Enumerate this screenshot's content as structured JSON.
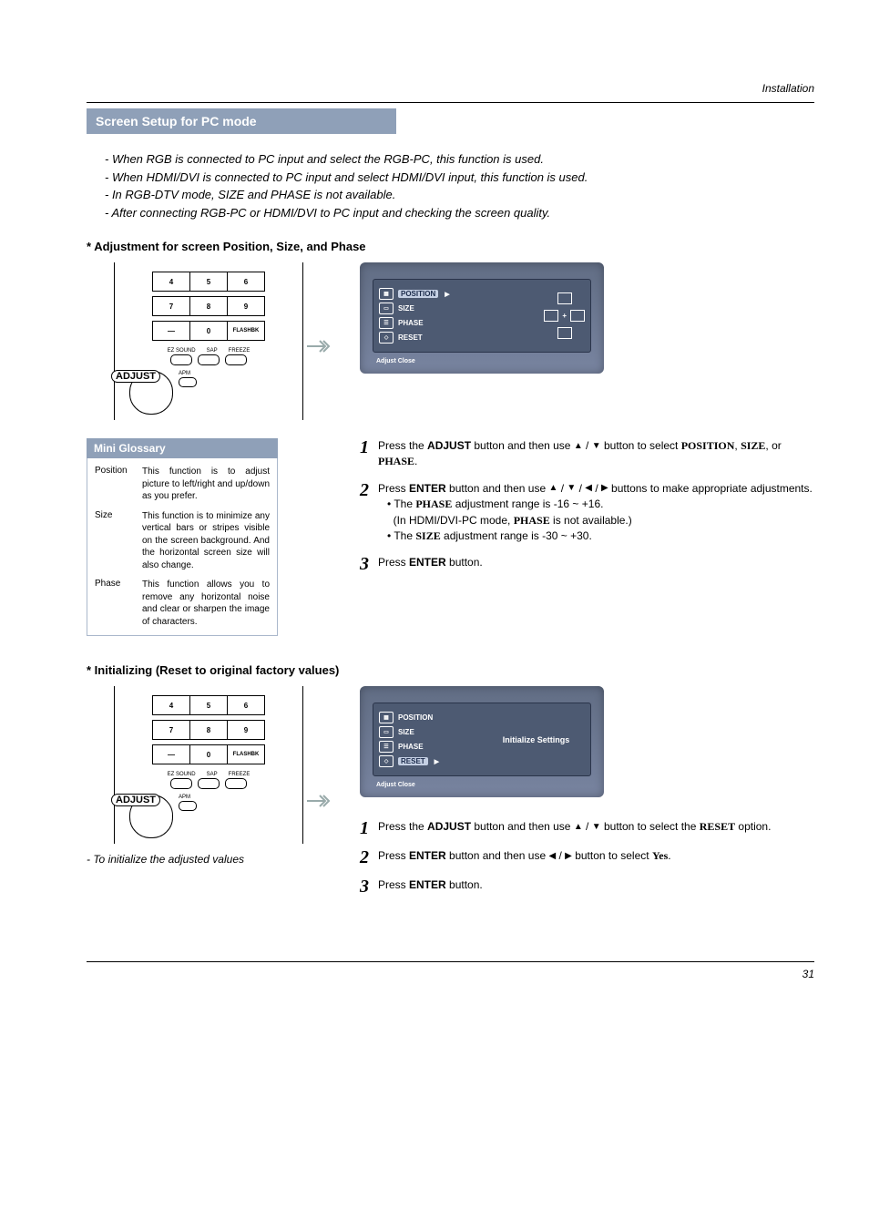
{
  "header": {
    "section": "Installation"
  },
  "title": "Screen Setup for PC mode",
  "notes": [
    "-  When RGB is connected to PC input and select the RGB-PC, this function is used.",
    "-  When HDMI/DVI is connected to PC input and select HDMI/DVI input, this function is used.",
    "-  In RGB-DTV mode, SIZE and PHASE is not available.",
    "-  After connecting RGB-PC or HDMI/DVI to PC input and checking the screen quality."
  ],
  "adjust": {
    "heading": "* Adjustment for screen Position, Size, and Phase",
    "remote": {
      "buttons": [
        [
          "4",
          "5",
          "6"
        ],
        [
          "7",
          "8",
          "9"
        ],
        [
          "—",
          "0",
          "FLASHBK"
        ]
      ],
      "top_labels": [
        "EZ SOUND",
        "SAP",
        "FREEZE"
      ],
      "adjust_label": "ADJUST",
      "apm_label": "APM"
    },
    "osd": {
      "items": [
        {
          "label": "POSITION",
          "selected": true,
          "arrow": true
        },
        {
          "label": "SIZE",
          "selected": false,
          "arrow": false
        },
        {
          "label": "PHASE",
          "selected": false,
          "arrow": false
        },
        {
          "label": "RESET",
          "selected": false,
          "arrow": false
        }
      ],
      "footer": "Adjust    Close"
    },
    "steps": [
      {
        "num": "1",
        "parts": [
          {
            "t": "Press the "
          },
          {
            "b": "ADJUST"
          },
          {
            "t": " button and then use "
          },
          {
            "sym": "▲"
          },
          {
            "t": " / "
          },
          {
            "sym": "▼"
          },
          {
            "t": " button to select "
          },
          {
            "bs": "POSITION"
          },
          {
            "t": ", "
          },
          {
            "bs": "SIZE"
          },
          {
            "t": ", or "
          },
          {
            "bs": "PHASE"
          },
          {
            "t": "."
          }
        ]
      },
      {
        "num": "2",
        "parts": [
          {
            "t": "Press "
          },
          {
            "b": "ENTER"
          },
          {
            "t": " button and then use "
          },
          {
            "sym": "▲"
          },
          {
            "t": " / "
          },
          {
            "sym": "▼"
          },
          {
            "t": " / "
          },
          {
            "sym": "◀"
          },
          {
            "t": " / "
          },
          {
            "sym": "▶"
          },
          {
            "t": " buttons to make appropriate adjustments."
          }
        ],
        "sub": [
          {
            "pre": "• The ",
            "b": "PHASE",
            "post": " adjustment range is -16 ~ +16."
          },
          {
            "plain": "(In HDMI/DVI-PC mode, ",
            "b": "PHASE",
            "post": " is not available.)"
          },
          {
            "pre": "• The ",
            "b": "SIZE",
            "post": " adjustment range is -30 ~ +30."
          }
        ]
      },
      {
        "num": "3",
        "parts": [
          {
            "t": "Press "
          },
          {
            "b": "ENTER"
          },
          {
            "t": " button."
          }
        ]
      }
    ]
  },
  "glossary": {
    "title": "Mini Glossary",
    "rows": [
      {
        "term": "Position",
        "def": "This function is to adjust picture to left/right and up/down as you prefer."
      },
      {
        "term": "Size",
        "def": "This function is to minimize any vertical bars or stripes visible on the screen background. And the horizontal screen size will also change."
      },
      {
        "term": "Phase",
        "def": "This function allows you to remove any horizontal noise and clear or sharpen the image of characters."
      }
    ]
  },
  "init": {
    "heading": "* Initializing (Reset to original factory values)",
    "note": "- To initialize the adjusted values",
    "osd": {
      "items": [
        {
          "label": "POSITION",
          "selected": false,
          "arrow": false
        },
        {
          "label": "SIZE",
          "selected": false,
          "arrow": false
        },
        {
          "label": "PHASE",
          "selected": false,
          "arrow": false
        },
        {
          "label": "RESET",
          "selected": true,
          "arrow": true
        }
      ],
      "right_text": "Initialize Settings",
      "footer": "Adjust    Close"
    },
    "steps": [
      {
        "num": "1",
        "parts": [
          {
            "t": "Press the "
          },
          {
            "b": "ADJUST"
          },
          {
            "t": " button and then use "
          },
          {
            "sym": "▲"
          },
          {
            "t": " / "
          },
          {
            "sym": "▼"
          },
          {
            "t": " button to select the "
          },
          {
            "bs": "RESET"
          },
          {
            "t": " option."
          }
        ]
      },
      {
        "num": "2",
        "parts": [
          {
            "t": "Press "
          },
          {
            "b": "ENTER"
          },
          {
            "t": " button and then use "
          },
          {
            "sym": "◀"
          },
          {
            "t": " / "
          },
          {
            "sym": "▶"
          },
          {
            "t": " button to select "
          },
          {
            "bs": "Yes"
          },
          {
            "t": "."
          }
        ]
      },
      {
        "num": "3",
        "parts": [
          {
            "t": "Press "
          },
          {
            "b": "ENTER"
          },
          {
            "t": " button."
          }
        ]
      }
    ]
  },
  "page_number": "31"
}
